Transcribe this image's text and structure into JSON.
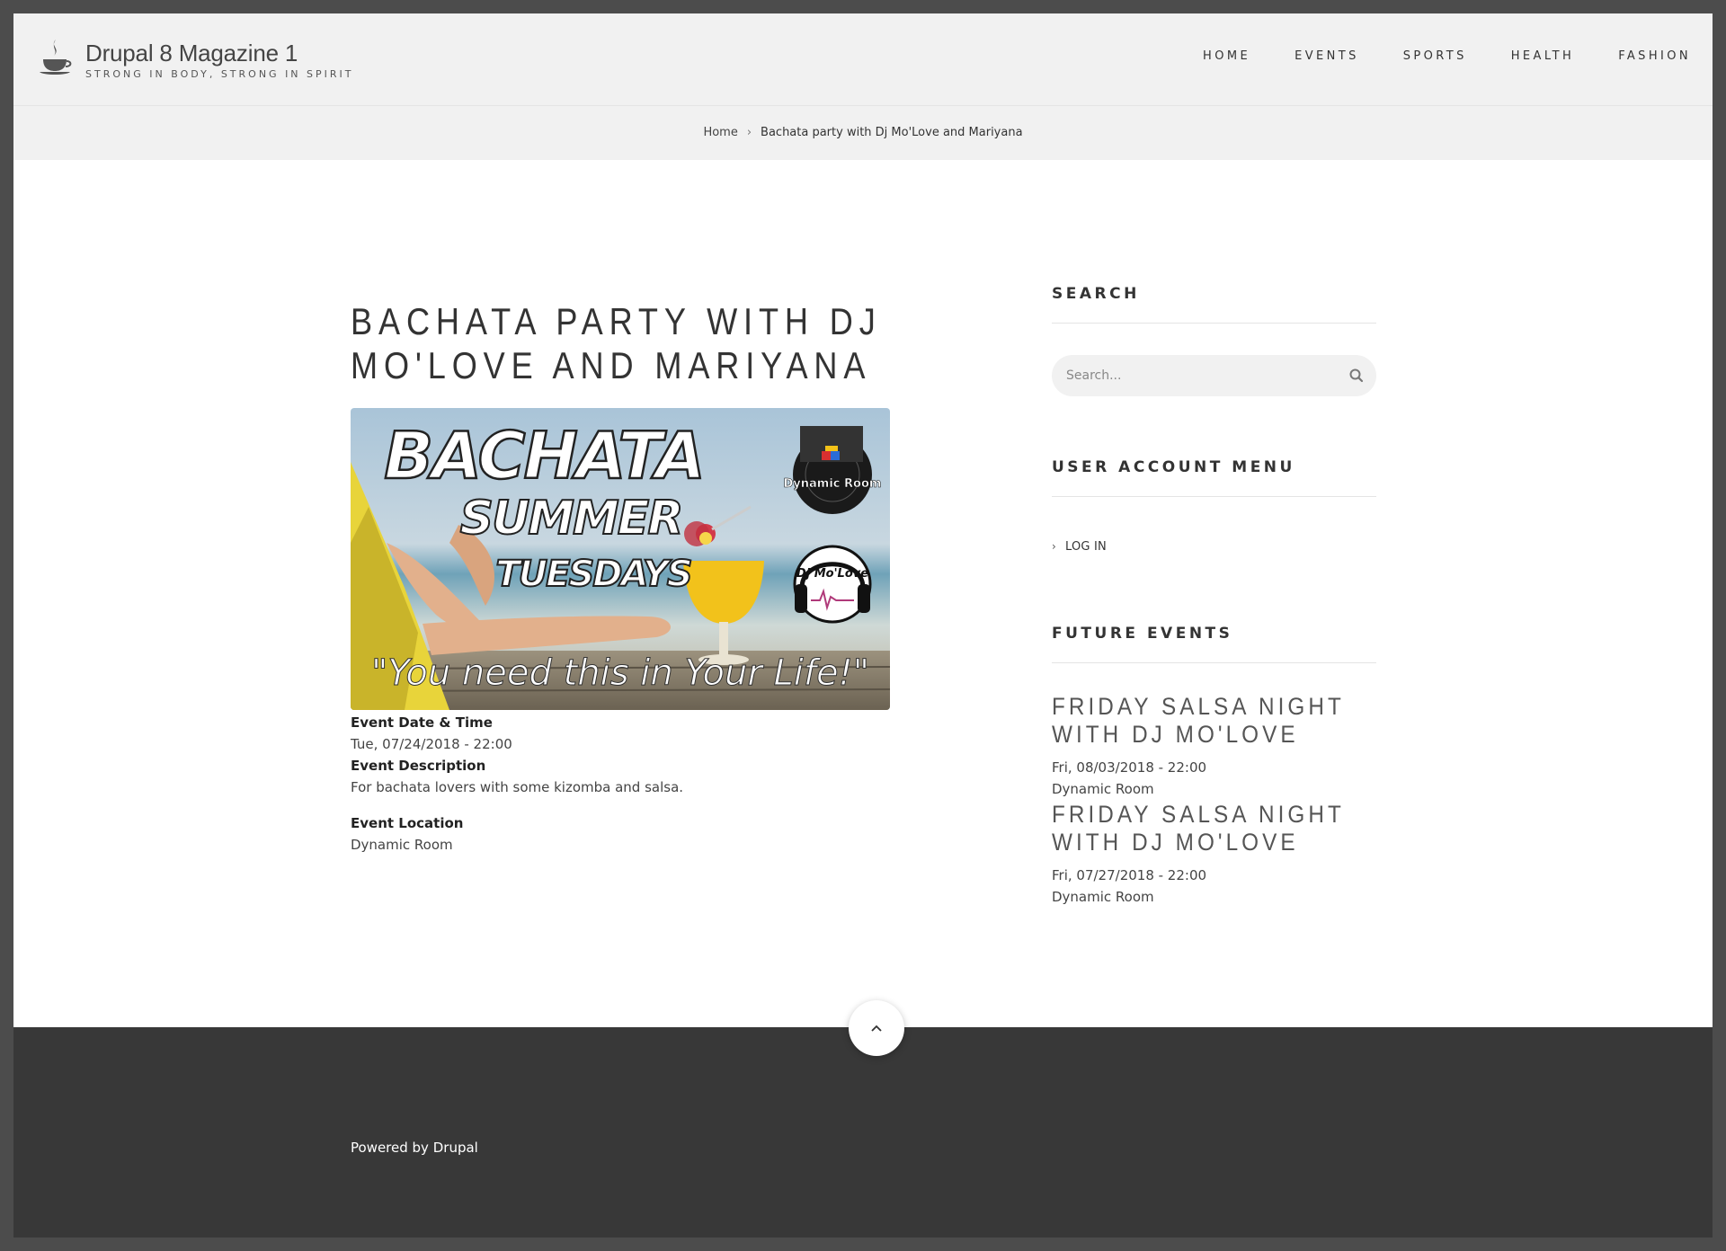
{
  "site": {
    "name": "Drupal 8 Magazine 1",
    "slogan": "STRONG IN BODY, STRONG IN SPIRIT"
  },
  "nav": {
    "items": [
      {
        "label": "HOME"
      },
      {
        "label": "EVENTS"
      },
      {
        "label": "SPORTS"
      },
      {
        "label": "HEALTH"
      },
      {
        "label": "FASHION"
      }
    ]
  },
  "breadcrumb": {
    "home": "Home",
    "separator": "›",
    "current": "Bachata party with Dj Mo'Love and Mariyana"
  },
  "article": {
    "title_line1": "BACHATA PARTY WITH DJ",
    "title_line2": "MO'LOVE AND MARIYANA",
    "image": {
      "headline1": "BACHATA",
      "headline2": "SUMMER",
      "headline3": "TUESDAYS",
      "tagline": "\"You need this in Your Life!\"",
      "logo1": "Dynamic Room",
      "logo2": "Dj Mo'Love"
    },
    "date_label": "Event Date & Time",
    "date_value": "Tue, 07/24/2018 - 22:00",
    "description_label": "Event Description",
    "description_value": "For bachata lovers with some kizomba and salsa.",
    "location_label": "Event Location",
    "location_value": "Dynamic Room"
  },
  "sidebar": {
    "search_title": "SEARCH",
    "search_placeholder": "Search...",
    "account_title": "USER ACCOUNT MENU",
    "login_label": "LOG IN",
    "future_title": "FUTURE EVENTS",
    "events": [
      {
        "title_line1": "FRIDAY SALSA NIGHT",
        "title_line2": "WITH DJ MO'LOVE",
        "date": "Fri, 08/03/2018 - 22:00",
        "location": "Dynamic Room"
      },
      {
        "title_line1": "FRIDAY SALSA NIGHT",
        "title_line2": "WITH DJ MO'LOVE",
        "date": "Fri, 07/27/2018 - 22:00",
        "location": "Dynamic Room"
      }
    ]
  },
  "footer": {
    "powered_prefix": "Powered by",
    "powered_link": "Drupal"
  },
  "icons": {
    "logo": "coffee-cup-icon",
    "search": "search-icon",
    "back_to_top": "chevron-up-icon",
    "login_chevron": "chevron-right-icon"
  }
}
